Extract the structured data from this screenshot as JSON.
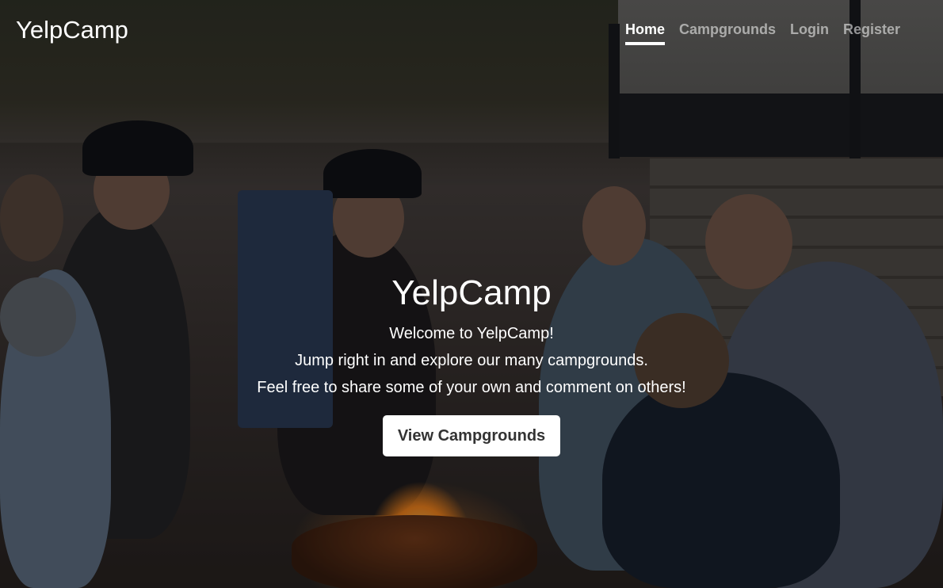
{
  "navbar": {
    "brand": "YelpCamp",
    "links": [
      {
        "label": "Home",
        "active": true
      },
      {
        "label": "Campgrounds",
        "active": false
      },
      {
        "label": "Login",
        "active": false
      },
      {
        "label": "Register",
        "active": false
      }
    ]
  },
  "hero": {
    "title": "YelpCamp",
    "lines": [
      "Welcome to YelpCamp!",
      "Jump right in and explore our many campgrounds.",
      "Feel free to share some of your own and comment on others!"
    ],
    "cta_label": "View Campgrounds"
  },
  "background": {
    "description_icon": "campfire-group-photo",
    "overlay_color": "#000000"
  }
}
